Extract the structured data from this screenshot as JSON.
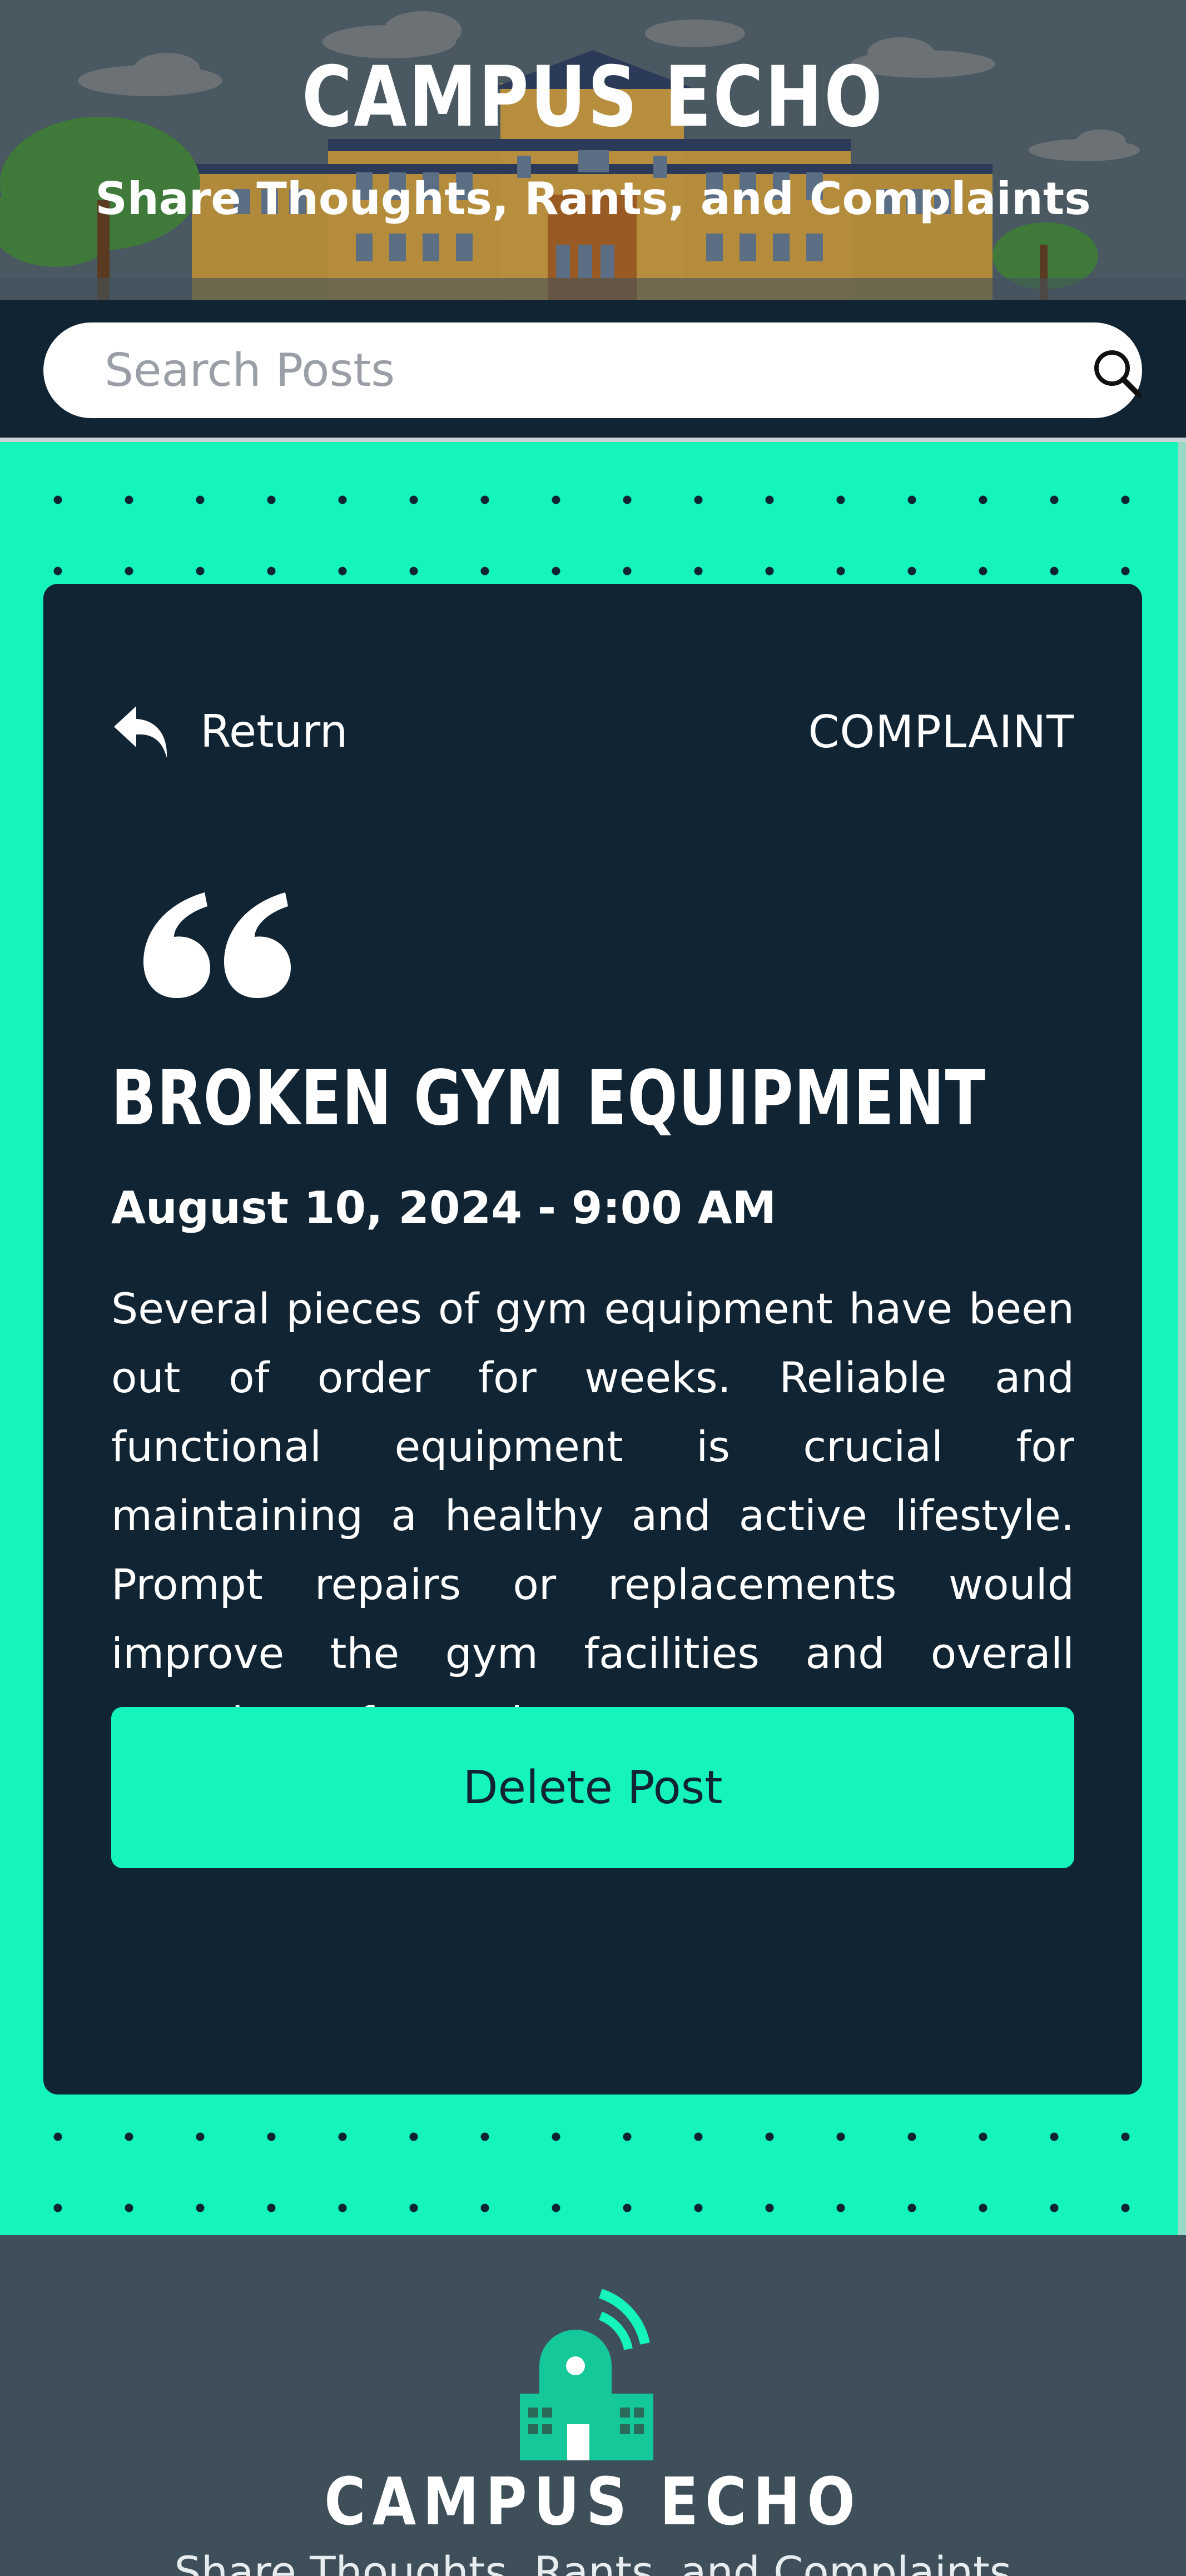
{
  "header": {
    "title": "CAMPUS ECHO",
    "subtitle": "Share Thoughts, Rants, and Complaints"
  },
  "search": {
    "placeholder": "Search Posts",
    "icon": "search-icon"
  },
  "post": {
    "return_label": "Return",
    "category": "COMPLAINT",
    "title": "BROKEN GYM EQUIPMENT",
    "date": "August 10, 2024 - 9:00 AM",
    "body": "Several pieces of gym equipment have been out of order for weeks. Reliable and functional equipment is crucial for maintaining a healthy and active lifestyle. Prompt repairs or replacements would improve the gym facilities and overall experience for students.",
    "delete_label": "Delete Post"
  },
  "footer": {
    "title": "CAMPUS ECHO",
    "subtitle": "Share Thoughts, Rants, and Complaints"
  },
  "colors": {
    "accent": "#14f4bb",
    "card": "#102433",
    "header_bg": "#4a5862",
    "footer_bg": "#3f4f5a"
  }
}
